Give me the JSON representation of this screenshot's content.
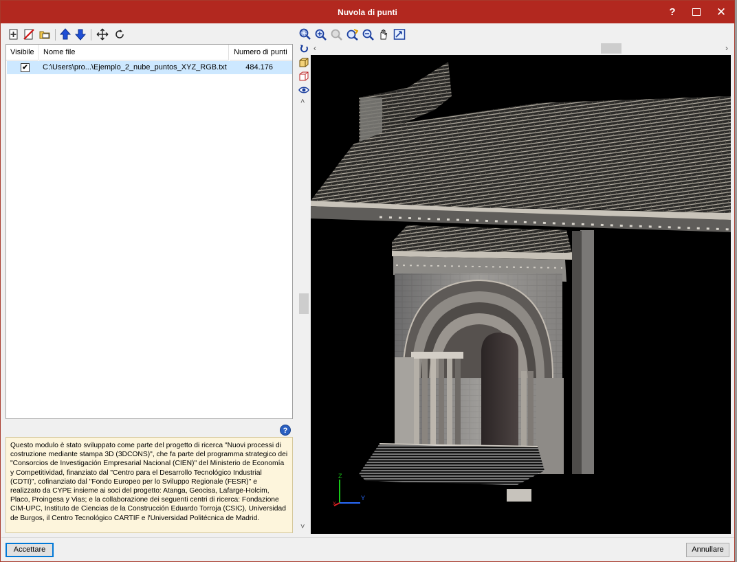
{
  "window": {
    "title": "Nuvola di punti"
  },
  "titlebar": {
    "help": "?",
    "close": "✕"
  },
  "left_toolbar": {
    "icons": [
      "add-file-icon",
      "delete-file-icon",
      "open-folder-icon",
      "move-up-icon",
      "move-down-icon",
      "move-icon",
      "rotate-icon"
    ]
  },
  "file_list": {
    "columns": [
      "Visibile",
      "Nome file",
      "Numero di punti"
    ],
    "rows": [
      {
        "visible": true,
        "checkmark": "✔",
        "file": "C:\\Users\\pro...\\Ejemplo_2_nube_puntos_XYZ_RGB.txt",
        "points": "484.176"
      }
    ]
  },
  "info": {
    "help": "?",
    "text": "Questo modulo è stato sviluppato come parte del progetto di ricerca \"Nuovi processi di costruzione mediante stampa 3D (3DCONS)\", che fa parte del programma strategico dei \"Consorcios de Investigación Empresarial Nacional (CIEN)\" del Ministerio de Economía y Competitividad, finanziato dal \"Centro para el Desarrollo Tecnológico Industrial (CDTI)\", cofinanziato dal \"Fondo Europeo per lo Sviluppo Regionale (FESR)\" e realizzato da CYPE insieme ai soci del progetto: Atanga, Geocisa, Lafarge-Holcim, Placo, Proingesa y Vias; e la collaborazione dei seguenti centri di ricerca: Fondazione CIM-UPC, Instituto de Ciencias de la Construcción Eduardo Torroja (CSIC), Universidad de Burgos, il Centro Tecnológico CARTIF e l'Universidad Politécnica de Madrid."
  },
  "viewer": {
    "toolbar_icons": [
      "zoom-window-icon",
      "zoom-all-icon",
      "zoom-disabled-icon",
      "rotate-view-icon",
      "zoom-out-icon",
      "pan-hand-icon",
      "fit-view-icon"
    ],
    "side_icons": [
      "undo-view-icon",
      "3d-box-icon",
      "3d-rotate-icon",
      "eye-icon"
    ],
    "axes": {
      "x": "X",
      "y": "Y",
      "z": "Z"
    },
    "colors": {
      "background": "#000000",
      "x_axis": "#e02020",
      "y_axis": "#2a6cff",
      "z_axis": "#18c818"
    }
  },
  "footer": {
    "ok": "Accettare",
    "cancel": "Annullare"
  }
}
